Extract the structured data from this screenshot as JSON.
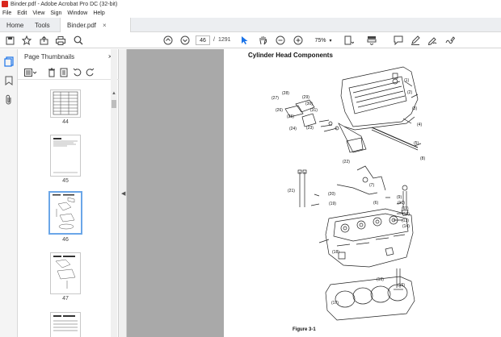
{
  "window": {
    "title": "Binder.pdf - Adobe Acrobat Pro DC (32-bit)"
  },
  "menu": {
    "items": [
      "File",
      "Edit",
      "View",
      "Sign",
      "Window",
      "Help"
    ]
  },
  "tabs": [
    {
      "label": "Home"
    },
    {
      "label": "Tools"
    },
    {
      "label": "Binder.pdf",
      "close": "×"
    }
  ],
  "toolbar": {
    "current_page": "46",
    "page_separator": "/",
    "total_pages": "1291",
    "zoom": "75%"
  },
  "thumbnails_panel": {
    "title": "Page Thumbnails",
    "close": "×",
    "pages": [
      {
        "label": "44"
      },
      {
        "label": "45"
      },
      {
        "label": "46",
        "selected": true
      },
      {
        "label": "47"
      }
    ]
  },
  "document": {
    "heading": "Cylinder Head Components",
    "figure_caption": "Figure 3-1",
    "callouts": [
      "(1)",
      "(2)",
      "(3)",
      "(4)",
      "(5)",
      "(6)",
      "(7)",
      "(8)",
      "(9)",
      "(10)",
      "(11)",
      "(12)",
      "(13)",
      "(14)",
      "(15)",
      "(16)",
      "(17)",
      "(18)",
      "(19)",
      "(20)",
      "(21)",
      "(22)",
      "(23)",
      "(24)",
      "(25)",
      "(26)",
      "(27)",
      "(28)",
      "(29)",
      "(30)",
      "(31)"
    ]
  },
  "colors": {
    "accent": "#1a73e8",
    "selection": "#6aa6e8",
    "canvas": "#a9a9a9",
    "app_red": "#d9261c"
  }
}
